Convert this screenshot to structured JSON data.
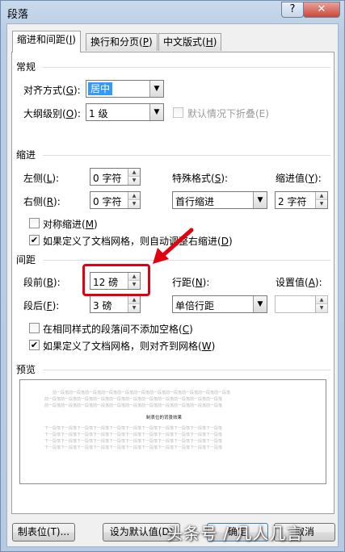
{
  "window": {
    "title": "段落",
    "help_label": "?",
    "close_label": "✕"
  },
  "tabs": [
    {
      "label": "缩进和间距(",
      "key": "I",
      "tail": ")"
    },
    {
      "label": "换行和分页(",
      "key": "P",
      "tail": ")"
    },
    {
      "label": "中文版式(",
      "key": "H",
      "tail": ")"
    }
  ],
  "general": {
    "section": "常规",
    "alignment_label": "对齐方式(",
    "alignment_key": "G",
    "alignment_tail": "):",
    "alignment_value": "居中",
    "outline_label": "大纲级别(",
    "outline_key": "O",
    "outline_tail": "):",
    "outline_value": "1 级",
    "collapse_label": "默认情况下折叠(E)",
    "collapse_checked": false
  },
  "indent": {
    "section": "缩进",
    "left_label": "左侧(",
    "left_key": "L",
    "left_tail": "):",
    "left_value": "0 字符",
    "right_label": "右侧(",
    "right_key": "R",
    "right_tail": "):",
    "right_value": "0 字符",
    "special_label": "特殊格式(",
    "special_key": "S",
    "special_tail": "):",
    "special_value": "首行缩进",
    "by_label": "缩进值(",
    "by_key": "Y",
    "by_tail": "):",
    "by_value": "2 字符",
    "mirror_label": "对称缩进(",
    "mirror_key": "M",
    "mirror_tail": ")",
    "mirror_checked": false,
    "auto_adjust_label": "如果定义了文档网格，则自动调整右缩进(",
    "auto_adjust_key": "D",
    "auto_adjust_tail": ")",
    "auto_adjust_checked": true
  },
  "spacing": {
    "section": "间距",
    "before_label": "段前(",
    "before_key": "B",
    "before_tail": "):",
    "before_value": "12 磅",
    "after_label": "段后(",
    "after_key": "F",
    "after_tail": "):",
    "after_value": "3 磅",
    "line_label": "行距(",
    "line_key": "N",
    "line_tail": "):",
    "line_value": "单倍行距",
    "at_label": "设置值(",
    "at_key": "A",
    "at_tail": "):",
    "at_value": "",
    "no_space_label": "在相同样式的段落间不添加空格(",
    "no_space_key": "C",
    "no_space_tail": ")",
    "no_space_checked": false,
    "snap_grid_label": "如果定义了文档网格，则对齐到网格(",
    "snap_grid_key": "W",
    "snap_grid_tail": ")",
    "snap_grid_checked": true
  },
  "preview": {
    "section": "预览",
    "prev_text": "前一段落前一段落前一段落前一段落前一段落前一段落前一段落前一段落前一段落前一段落前一段落",
    "current_text": "制表位的背景效果",
    "next_text": "下一段落下一段落下一段落下一段落下一段落下一段落下一段落下一段落下一段落下一段落下一段落"
  },
  "buttons": {
    "tabs_label": "制表位(T)...",
    "default_label": "设为默认值(D)",
    "ok_label": "确定",
    "cancel_label": "取消"
  },
  "watermark": "头条号 / 几人几言",
  "colors": {
    "highlight": "#e0000f",
    "selection": "#3399ff"
  }
}
